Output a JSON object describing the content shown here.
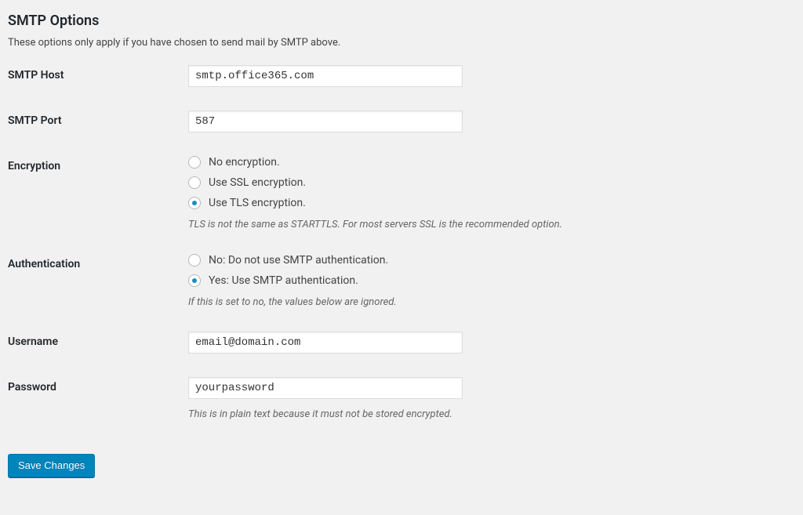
{
  "section": {
    "title": "SMTP Options",
    "description": "These options only apply if you have chosen to send mail by SMTP above."
  },
  "fields": {
    "smtp_host": {
      "label": "SMTP Host",
      "value": "smtp.office365.com"
    },
    "smtp_port": {
      "label": "SMTP Port",
      "value": "587"
    },
    "encryption": {
      "label": "Encryption",
      "options": {
        "none": "No encryption.",
        "ssl": "Use SSL encryption.",
        "tls": "Use TLS encryption."
      },
      "selected": "tls",
      "description": "TLS is not the same as STARTTLS. For most servers SSL is the recommended option."
    },
    "authentication": {
      "label": "Authentication",
      "options": {
        "no": "No: Do not use SMTP authentication.",
        "yes": "Yes: Use SMTP authentication."
      },
      "selected": "yes",
      "description": "If this is set to no, the values below are ignored."
    },
    "username": {
      "label": "Username",
      "value": "email@domain.com"
    },
    "password": {
      "label": "Password",
      "value": "yourpassword",
      "description": "This is in plain text because it must not be stored encrypted."
    }
  },
  "submit": {
    "label": "Save Changes"
  }
}
